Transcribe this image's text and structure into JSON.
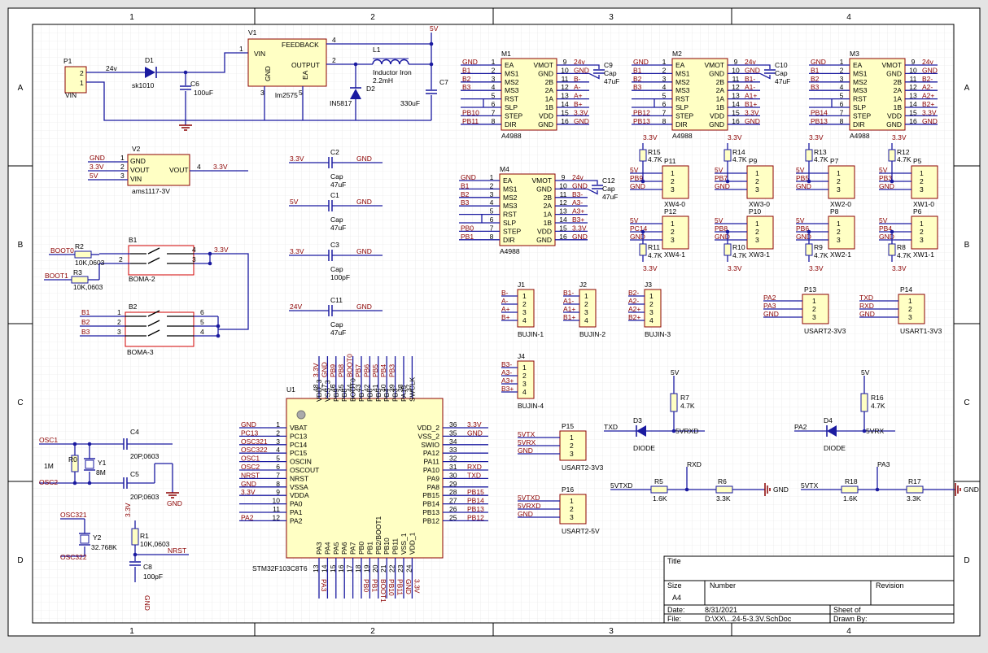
{
  "border": {
    "cols": [
      "1",
      "2",
      "3",
      "4"
    ],
    "rows": [
      "A",
      "B",
      "C",
      "D"
    ]
  },
  "title_block": {
    "title_label": "Title",
    "size_label": "Size",
    "size_value": "A4",
    "number_label": "Number",
    "revision_label": "Revision",
    "date_label": "Date:",
    "date_value": "8/31/2021",
    "file_label": "File:",
    "file_value": "D:\\XX\\...24-5-3.3V.SchDoc",
    "sheet_label": "Sheet   of",
    "drawn_label": "Drawn By:"
  },
  "power": {
    "p1_ref": "P1",
    "p1_value": "VIN",
    "p1_pin2": "2",
    "p1_pin1": "1",
    "net_24v": "24v",
    "d1_ref": "D1",
    "d1_value": "sk1010",
    "c6_ref": "C6",
    "c6_value": "100uF",
    "v1_ref": "V1",
    "v1_value": "lm2575",
    "v1_vin": "VIN",
    "v1_feedback": "FEEDBACK",
    "v1_output": "OUTPUT",
    "v1_gnd": "GND",
    "v1_ea": "EA",
    "v1_pin1": "1",
    "v1_pin4": "4",
    "v1_pin2": "2",
    "v1_pin3": "3",
    "v1_pin5": "5",
    "l1_ref": "L1",
    "l1_value1": "Inductor Iron",
    "l1_value2": "2.2mH",
    "d2_ref": "D2",
    "d2_value": "IN5817",
    "c7_ref": "C7",
    "c7_value": "330uF",
    "net_5v": "5V",
    "v2_ref": "V2",
    "v2_value": "ams1117-3V",
    "v2_gnd": "GND",
    "v2_vout": "VOUT",
    "v2_vin": "VIN",
    "v2_vout_r": "VOUT",
    "v2_pin1": "1",
    "v2_pin2": "2",
    "v2_pin3": "3",
    "v2_pin4": "4",
    "v2_net1": "GND",
    "v2_net2": "3.3V",
    "v2_net3": "5V",
    "v2_net4": "3.3V"
  },
  "caps": [
    {
      "ref": "C2",
      "left": "3.3V",
      "right": "GND",
      "l1": "Cap",
      "l2": "47uF"
    },
    {
      "ref": "C1",
      "left": "5V",
      "right": "GND",
      "l1": "Cap",
      "l2": "47uF"
    },
    {
      "ref": "C3",
      "left": "3.3V",
      "right": "GND",
      "l1": "Cap",
      "l2": "100pF"
    },
    {
      "ref": "C11",
      "left": "24V",
      "right": "GND",
      "l1": "Cap",
      "l2": "47uF"
    }
  ],
  "drivers": {
    "part": "A4988",
    "left_pins": [
      "EA",
      "MS1",
      "MS2",
      "MS3",
      "RST",
      "SLP",
      "STEP",
      "DIR"
    ],
    "right_pins": [
      "VMOT",
      "GND",
      "2B",
      "2A",
      "1A",
      "1B",
      "VDD",
      "GND"
    ],
    "left_nums": [
      "1",
      "2",
      "3",
      "4",
      "5",
      "6",
      "7",
      "8"
    ],
    "right_nums": [
      "9",
      "10",
      "11",
      "12",
      "13",
      "14",
      "15",
      "16"
    ],
    "m1": {
      "ref": "M1",
      "lnets": [
        "GND",
        "B1",
        "B2",
        "B3",
        "",
        "",
        "PB10",
        "PB11"
      ],
      "rnets": [
        "24v",
        "GND",
        "B-",
        "A-",
        "A+",
        "B+",
        "3.3V",
        "GND"
      ],
      "cap": "C9",
      "capl1": "Cap",
      "capl2": "47uF"
    },
    "m2": {
      "ref": "M2",
      "lnets": [
        "GND",
        "B1",
        "B2",
        "B3",
        "",
        "",
        "PB12",
        "PB13"
      ],
      "rnets": [
        "24v",
        "GND",
        "B1-",
        "A1-",
        "A1+",
        "B1+",
        "3.3V",
        "GND"
      ],
      "cap": "C10",
      "capl1": "Cap",
      "capl2": "47uF"
    },
    "m3": {
      "ref": "M3",
      "lnets": [
        "GND",
        "B1",
        "B2",
        "B3",
        "",
        "",
        "PB14",
        "PB13"
      ],
      "rnets": [
        "24v",
        "GND",
        "B2-",
        "A2-",
        "A2+",
        "B2+",
        "3.3V",
        "GND"
      ]
    },
    "m4": {
      "ref": "M4",
      "lnets": [
        "GND",
        "B1",
        "B2",
        "B3",
        "",
        "",
        "PB0",
        "PB1"
      ],
      "rnets": [
        "24v",
        "GND",
        "B3-",
        "A3-",
        "A3+",
        "B3+",
        "3.3V",
        "GND"
      ],
      "cap": "C12",
      "capl1": "Cap",
      "capl2": "47uF"
    }
  },
  "sensors": [
    {
      "ref": "P11",
      "part": "XW4-0",
      "res": "R15",
      "rv": "4.7K",
      "top": "3.3V",
      "n1": "5V",
      "n2": "PB9",
      "n3": "GND"
    },
    {
      "ref": "P9",
      "part": "XW3-0",
      "res": "R14",
      "rv": "4.7K",
      "top": "3.3V",
      "n1": "5V",
      "n2": "PB7",
      "n3": "GND"
    },
    {
      "ref": "P7",
      "part": "XW2-0",
      "res": "R13",
      "rv": "4.7K",
      "top": "3.3V",
      "n1": "5V",
      "n2": "PB5",
      "n3": "GND"
    },
    {
      "ref": "P5",
      "part": "XW1-0",
      "res": "R12",
      "rv": "4.7K",
      "top": "3.3V",
      "n1": "5V",
      "n2": "PB3",
      "n3": "GND"
    },
    {
      "ref": "P12",
      "part": "XW4-1",
      "res": "R11",
      "rv": "4.7K",
      "top": "3.3V",
      "n1": "5V",
      "n2": "PC14",
      "n3": "GND"
    },
    {
      "ref": "P10",
      "part": "XW3-1",
      "res": "R10",
      "rv": "4.7K",
      "top": "3.3V",
      "n1": "5V",
      "n2": "PB8",
      "n3": "GND"
    },
    {
      "ref": "P8",
      "part": "XW2-1",
      "res": "R9",
      "rv": "4.7K",
      "top": "3.3V",
      "n1": "5V",
      "n2": "PB6",
      "n3": "GND"
    },
    {
      "ref": "P6",
      "part": "XW1-1",
      "res": "R8",
      "rv": "4.7K",
      "top": "3.3V",
      "n1": "5V",
      "n2": "PB4",
      "n3": "GND"
    }
  ],
  "motor_conns": [
    {
      "ref": "J1",
      "part": "BUJIN-1",
      "nets": [
        "B-",
        "A-",
        "A+",
        "B+"
      ]
    },
    {
      "ref": "J2",
      "part": "BUJIN-2",
      "nets": [
        "B1-",
        "A1-",
        "A1+",
        "B1+"
      ]
    },
    {
      "ref": "J3",
      "part": "BUJIN-3",
      "nets": [
        "B2-",
        "A2-",
        "A2+",
        "B2+"
      ]
    },
    {
      "ref": "J4",
      "part": "BUJIN-4",
      "nets": [
        "B3-",
        "A3-",
        "A3+",
        "B3+"
      ]
    }
  ],
  "uart": {
    "p13": {
      "ref": "P13",
      "part": "USART2-3V3",
      "nets": [
        "PA2",
        "PA3",
        "GND"
      ]
    },
    "p14": {
      "ref": "P14",
      "part": "USART1-3V3",
      "nets": [
        "TXD",
        "RXD",
        "GND"
      ]
    },
    "p15": {
      "ref": "P15",
      "part": "USART2-3V3",
      "nets": [
        "5VTX",
        "5VRX",
        "GND"
      ]
    },
    "p16": {
      "ref": "P16",
      "part": "USART2-5V",
      "nets": [
        "5VTXD",
        "5VRXD",
        "GND"
      ]
    }
  },
  "level_shift": {
    "left": {
      "d": "D3",
      "dv": "DIODE",
      "r_up": "R7",
      "r_up_v": "4.7K",
      "vcc": "5V",
      "in": "TXD",
      "out": "5VRXD",
      "r1": "R5",
      "r1v": "1.6K",
      "r2": "R6",
      "r2v": "3.3K",
      "node": "RXD",
      "src": "5VTXD",
      "gnd": "GND"
    },
    "right": {
      "d": "D4",
      "dv": "DIODE",
      "r_up": "R16",
      "r_up_v": "4.7K",
      "vcc": "5V",
      "in": "PA2",
      "out": "5VRX",
      "r1": "R18",
      "r1v": "1.6K",
      "r2": "R17",
      "r2v": "3.3K",
      "node": "PA3",
      "src": "5VTX",
      "gnd": "GND"
    }
  },
  "boot": {
    "b1_ref": "B1",
    "b1_value": "BOMA-2",
    "b2_ref": "B2",
    "b2_value": "BOMA-3",
    "r2": "R2",
    "r2v": "10K,0603",
    "r3": "R3",
    "r3v": "10K,0603",
    "boot0": "BOOT0",
    "boot1": "BOOT1",
    "net33": "3.3V",
    "b1_pins": [
      "4",
      "2",
      "3"
    ],
    "b2_pins": [
      "1",
      "2",
      "3",
      "6",
      "5",
      "4"
    ],
    "b2_nets": [
      "B1",
      "B2",
      "B3"
    ]
  },
  "osc": {
    "osc1": "OSC1",
    "osc2": "OSC2",
    "r0": "R0",
    "r0v": "1M",
    "y1": "Y1",
    "y1v": "8M",
    "c4": "C4",
    "c4v": "20P,0603",
    "c5": "C5",
    "c5v": "20P,0603",
    "gnd": "GND",
    "osc321": "OSC321",
    "osc322": "OSC322",
    "y2": "Y2",
    "y2v": "32.768K",
    "r1": "R1",
    "r1v": "10K,0603",
    "c8": "C8",
    "c8v": "100pF",
    "v33": "3.3V",
    "nrst": "NRST",
    "c8gnd": "GND"
  },
  "mcu": {
    "ref": "U1",
    "part": "STM32F103C8T6",
    "left_pins": [
      "VBAT",
      "PC13",
      "PC14",
      "PC15",
      "OSCIN",
      "OSCOUT",
      "NRST",
      "VSSA",
      "VDDA",
      "PA0",
      "PA1",
      "PA2"
    ],
    "left_nums": [
      "1",
      "2",
      "3",
      "4",
      "5",
      "6",
      "7",
      "8",
      "9",
      "10",
      "11",
      "12"
    ],
    "left_nets": [
      "GND",
      "PC13",
      "OSC321",
      "OSC322",
      "OSC1",
      "OSC2",
      "NRST",
      "GND",
      "3.3V",
      "",
      "",
      "PA2"
    ],
    "right_pins": [
      "VDD_2",
      "VSS_2",
      "SWIO",
      "PA12",
      "PA11",
      "PA10",
      "PA9",
      "PA8",
      "PB15",
      "PB14",
      "PB13",
      "PB12"
    ],
    "right_nums": [
      "36",
      "35",
      "34",
      "33",
      "32",
      "31",
      "30",
      "29",
      "28",
      "27",
      "26",
      "25"
    ],
    "right_nets": [
      "3.3V",
      "GND",
      "",
      "",
      "",
      "RXD",
      "TXD",
      "",
      "PB15",
      "PB14",
      "PB13",
      "PB12"
    ],
    "top_pins": [
      "VDD_3",
      "VSS_3",
      "PB9",
      "PB8",
      "BOOT0",
      "PB7",
      "PB6",
      "PB5",
      "PB4",
      "PB3",
      "PA15",
      "SWCLK"
    ],
    "top_nums": [
      "48",
      "47",
      "46",
      "45",
      "44",
      "43",
      "42",
      "41",
      "40",
      "39",
      "38",
      "37"
    ],
    "top_nets": [
      "3.3V",
      "GND",
      "PB9",
      "PB8",
      "BOOT0",
      "PB7",
      "PB6",
      "PB5",
      "PB4",
      "PB3",
      "",
      ""
    ],
    "bottom_pins": [
      "PA3",
      "PA4",
      "PA5",
      "PA6",
      "PA7",
      "PB0",
      "PB1",
      "PB2/BOOT1",
      "PB10",
      "PB11",
      "VSS_1",
      "VDD_1"
    ],
    "bottom_nums": [
      "13",
      "14",
      "15",
      "16",
      "17",
      "18",
      "19",
      "20",
      "21",
      "22",
      "23",
      "24"
    ],
    "bottom_nets": [
      "PA3",
      "",
      "",
      "",
      "",
      "PB0",
      "PB1",
      "BOOT1",
      "PB10",
      "PB11",
      "GND",
      "3.3V"
    ]
  }
}
